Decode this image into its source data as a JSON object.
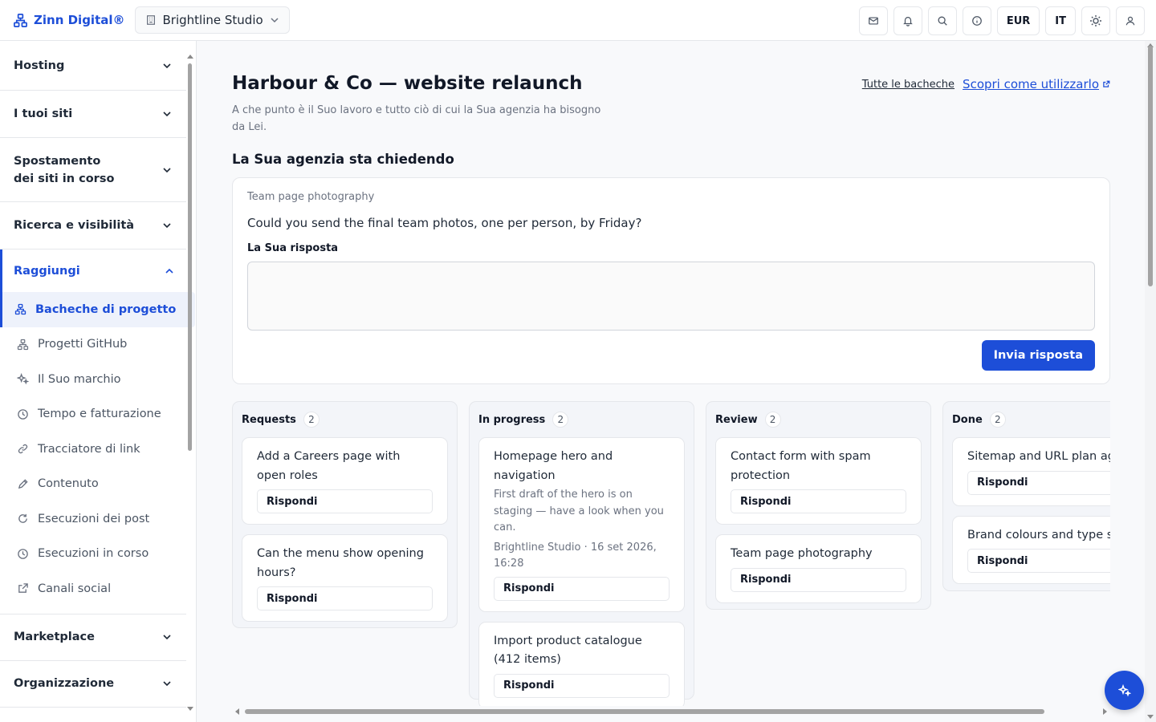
{
  "topbar": {
    "brand": "Zinn Digital®",
    "org_switcher": "Brightline Studio",
    "currency": "EUR",
    "language": "IT"
  },
  "sidebar": {
    "sections": [
      {
        "label": "Hosting",
        "expanded": false
      },
      {
        "label": "I tuoi siti",
        "expanded": false
      },
      {
        "label": "Spostamento dei siti in corso",
        "expanded": false
      },
      {
        "label": "Ricerca e visibilità",
        "expanded": false
      },
      {
        "label": "Raggiungi",
        "expanded": true
      },
      {
        "label": "Marketplace",
        "expanded": false
      },
      {
        "label": "Organizzazione",
        "expanded": false
      }
    ],
    "raggiungi_items": [
      {
        "label": "Bacheche di progetto",
        "icon": "project-board-icon",
        "active": true
      },
      {
        "label": "Progetti GitHub",
        "icon": "github-icon"
      },
      {
        "label": "Il Suo marchio",
        "icon": "sparkle-icon"
      },
      {
        "label": "Tempo e fatturazione",
        "icon": "clock-icon"
      },
      {
        "label": "Tracciatore di link",
        "icon": "link-icon"
      },
      {
        "label": "Contenuto",
        "icon": "pencil-icon"
      },
      {
        "label": "Esecuzioni dei post",
        "icon": "refresh-icon"
      },
      {
        "label": "Esecuzioni in corso",
        "icon": "clock-icon"
      },
      {
        "label": "Canali social",
        "icon": "external-link-icon"
      }
    ]
  },
  "header": {
    "title": "Harbour & Co — website relaunch",
    "subtitle": "A che punto è il Suo lavoro e tutto ciò di cui la Sua agenzia ha bisogno da Lei.",
    "all_boards_link": "Tutte le bacheche",
    "learn_link": "Scopri come utilizzarlo"
  },
  "asking": {
    "title": "La Sua agenzia sta chiedendo",
    "card_tag": "Team page photography",
    "question": "Could you send the final team photos, one per person, by Friday?",
    "answer_label": "La Sua risposta",
    "answer_value": "",
    "send_label": "Invia risposta"
  },
  "board": {
    "reply_label": "Rispondi",
    "columns": [
      {
        "name": "Requests",
        "count": "2",
        "cards": [
          {
            "title": "Add a Careers page with open roles"
          },
          {
            "title": "Can the menu show opening hours?"
          }
        ]
      },
      {
        "name": "In progress",
        "count": "2",
        "cards": [
          {
            "title": "Homepage hero and navigation",
            "note": "First draft of the hero is on staging — have a look when you can.",
            "meta": "Brightline Studio · 16 set 2026, 16:28"
          },
          {
            "title": "Import product catalogue (412 items)"
          }
        ]
      },
      {
        "name": "Review",
        "count": "2",
        "cards": [
          {
            "title": "Contact form with spam protection"
          },
          {
            "title": "Team page photography"
          }
        ]
      },
      {
        "name": "Done",
        "count": "2",
        "cards": [
          {
            "title": "Sitemap and URL plan agreed"
          },
          {
            "title": "Brand colours and type set"
          }
        ]
      }
    ]
  },
  "colors": {
    "accent": "#1d4ed8",
    "text": "#1f2937",
    "muted": "#6b7280",
    "border": "#e5e7eb"
  }
}
